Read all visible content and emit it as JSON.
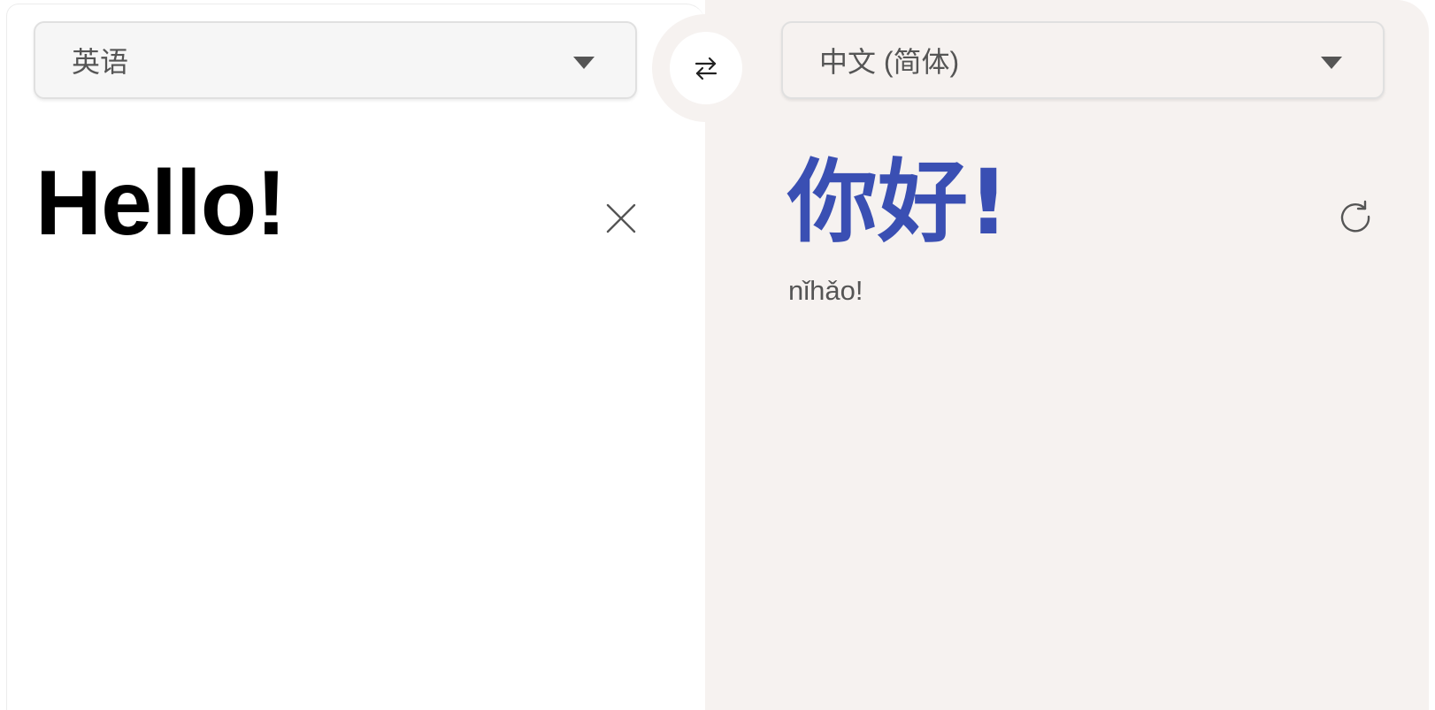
{
  "source": {
    "language": "英语",
    "text": "Hello!",
    "clear_icon": "close-icon"
  },
  "target": {
    "language": "中文 (简体)",
    "text": "你好!",
    "romanization": "nǐhǎo!",
    "refresh_icon": "refresh-icon"
  },
  "swap": {
    "icon": "swap-arrows-icon"
  },
  "colors": {
    "target_text": "#3a4fb3",
    "right_panel_bg": "#f6f2f0",
    "left_panel_bg": "#ffffff",
    "muted_text": "#555555"
  }
}
